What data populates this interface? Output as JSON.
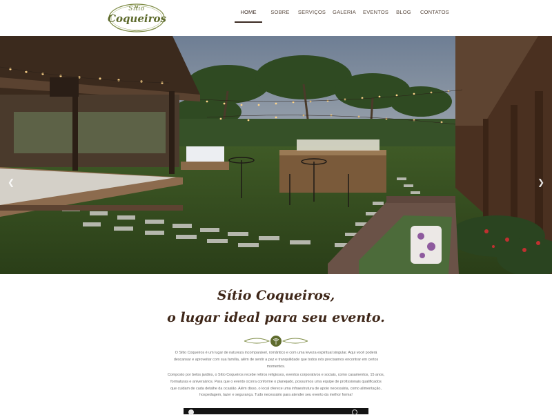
{
  "logo": {
    "line1": "Sítio",
    "line2": "Coqueiros",
    "icon": "palm-logo-icon"
  },
  "nav": {
    "items": [
      {
        "label": "HOME",
        "active": true
      },
      {
        "label": "SOBRE",
        "active": false
      },
      {
        "label": "SERVIÇOS",
        "active": false
      },
      {
        "label": "GALERIA",
        "active": false
      },
      {
        "label": "EVENTOS",
        "active": false
      },
      {
        "label": "BLOG",
        "active": false
      },
      {
        "label": "CONTATOS",
        "active": false
      }
    ]
  },
  "hero": {
    "prev_icon": "chevron-left-icon",
    "next_icon": "chevron-right-icon"
  },
  "intro": {
    "title_line1": "Sítio Coqueiros,",
    "title_line2": "o lugar ideal para seu evento.",
    "ornament_icon": "palm-ornament-icon",
    "paragraph1": "O Sítio Coqueiros é um lugar de natureza incomparável, romântico e com uma leveza espiritual singular. Aqui você poderá descansar e aproveitar com sua família, além de sentir a paz e tranquilidade que todos nós precisamos encontrar em certos momentos.",
    "paragraph2": "Composto por belos jardins, o Sítio Coqueiros recebe retiros religiosos, eventos corporativos e sociais, como casamentos, 15 anos, formaturas e aniversários. Para que o evento ocorra conforme o planejado, possuímos uma equipe de profissionais qualificados que cuidam de cada detalhe da ocasião. Além disso, o local oferece uma infraestrutura de apoio necessária, como alimentação, hospedagem, lazer e segurança. Tudo necessário para atender seu evento da melhor forma!"
  },
  "colors": {
    "brand_green": "#5e6b2d",
    "title_brown": "#3e2618",
    "nav_text": "#5a4a3f"
  }
}
